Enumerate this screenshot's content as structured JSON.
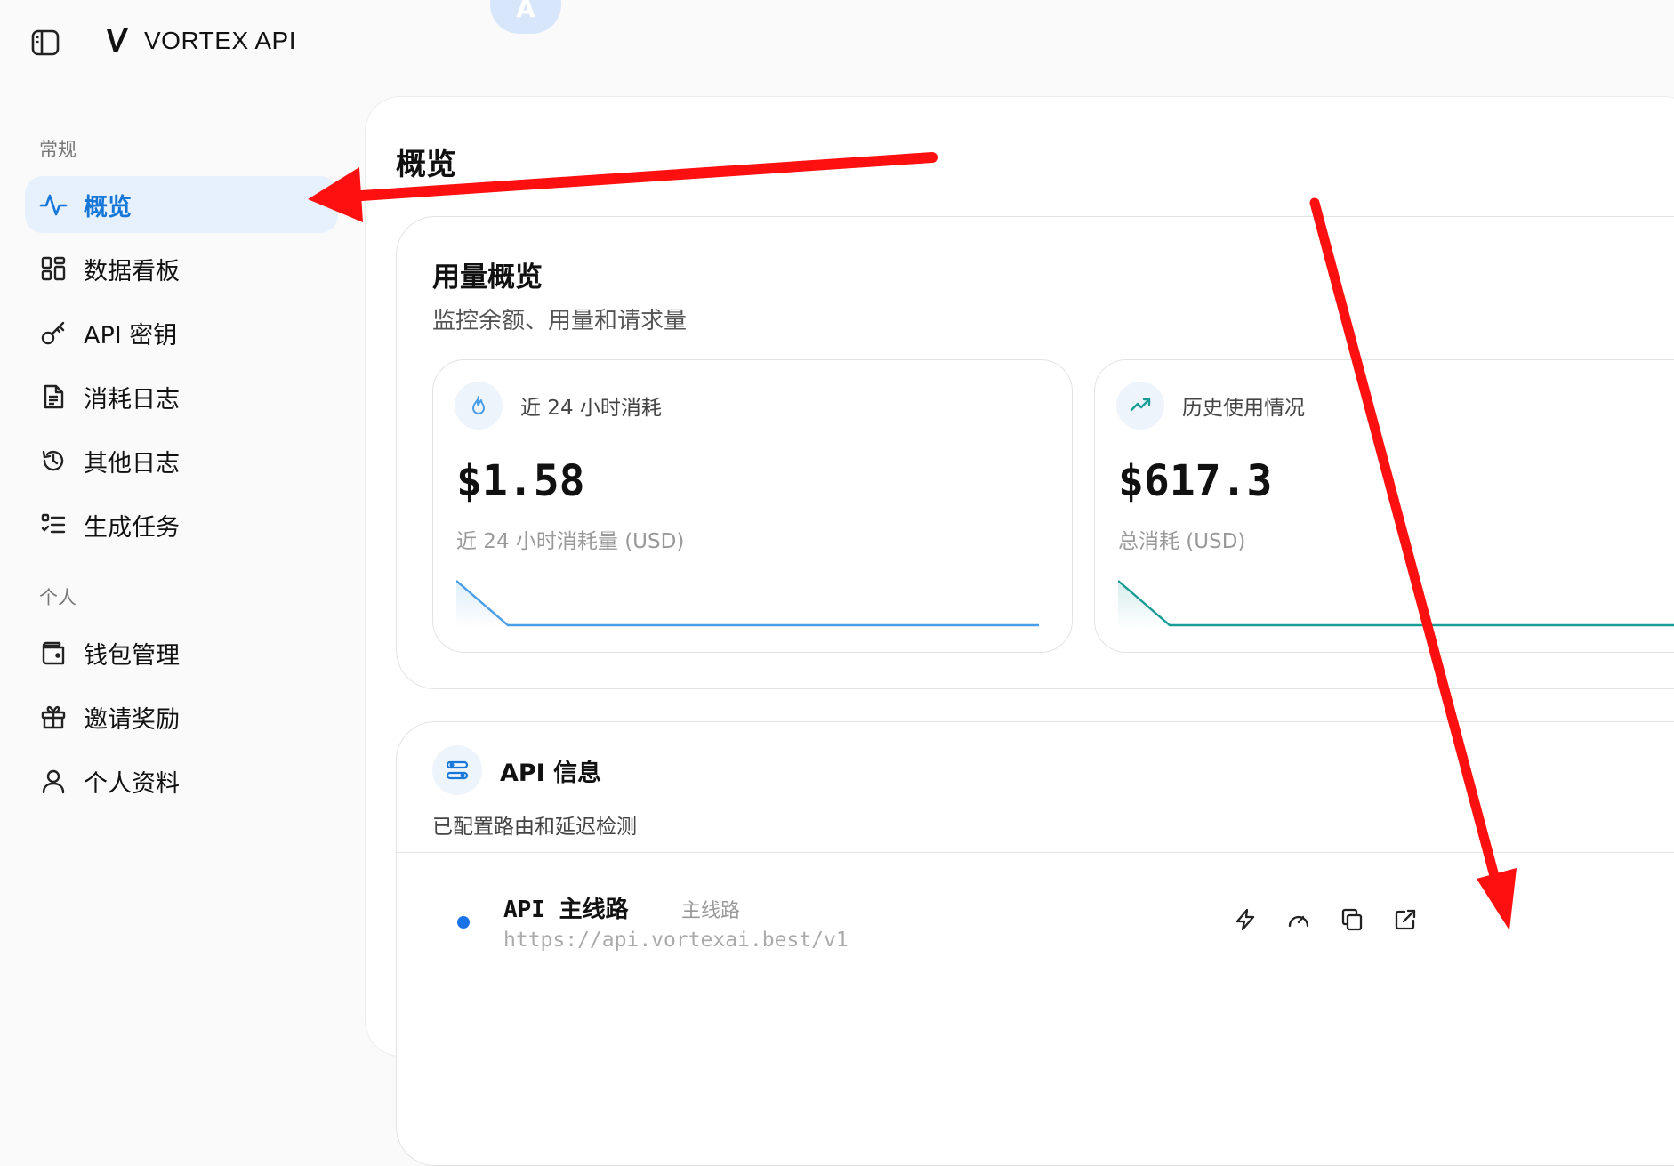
{
  "brand": {
    "name": "VORTEX API",
    "language_badge": "A"
  },
  "sidebar": {
    "sections": [
      {
        "label": "常规"
      },
      {
        "label": "个人"
      }
    ],
    "items": [
      {
        "label": "概览",
        "icon": "activity-icon",
        "active": true
      },
      {
        "label": "数据看板",
        "icon": "grid-icon"
      },
      {
        "label": "API 密钥",
        "icon": "key-icon"
      },
      {
        "label": "消耗日志",
        "icon": "document-icon"
      },
      {
        "label": "其他日志",
        "icon": "history-icon"
      },
      {
        "label": "生成任务",
        "icon": "task-list-icon"
      },
      {
        "label": "钱包管理",
        "icon": "wallet-icon"
      },
      {
        "label": "邀请奖励",
        "icon": "gift-icon"
      },
      {
        "label": "个人资料",
        "icon": "user-icon"
      }
    ]
  },
  "main": {
    "title": "概览",
    "usage": {
      "title": "用量概览",
      "subtitle": "监控余额、用量和请求量",
      "stats": [
        {
          "label": "近 24 小时消耗",
          "value": "$1.58",
          "caption": "近 24 小时消耗量 (USD)",
          "icon": "flame-icon",
          "accent": "#4a9ee8"
        },
        {
          "label": "历史使用情况",
          "value": "$617.3",
          "caption": "总消耗 (USD)",
          "icon": "trending-up-icon",
          "accent": "#1a9c96"
        }
      ]
    },
    "api": {
      "title": "API 信息",
      "subtitle": "已配置路由和延迟检测",
      "routes": [
        {
          "name": "API 主线路",
          "tag": "主线路",
          "url": "https://api.vortexai.best/v1",
          "status_color": "#1a73e8"
        }
      ],
      "actions": [
        "lightning-icon",
        "speedometer-icon",
        "copy-icon",
        "external-link-icon"
      ]
    }
  },
  "colors": {
    "accent": "#1677d8",
    "active_bg": "#e6f1fd",
    "annotation_arrow": "#ff1010"
  }
}
